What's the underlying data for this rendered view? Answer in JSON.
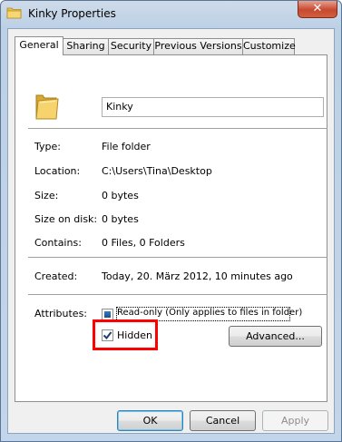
{
  "window": {
    "title": "Kinky Properties",
    "close_glyph": "✕"
  },
  "tabs": [
    {
      "label": "General",
      "active": true
    },
    {
      "label": "Sharing"
    },
    {
      "label": "Security"
    },
    {
      "label": "Previous Versions"
    },
    {
      "label": "Customize"
    }
  ],
  "general": {
    "name_value": "Kinky",
    "type_label": "Type:",
    "type_value": "File folder",
    "location_label": "Location:",
    "location_value": "C:\\Users\\Tina\\Desktop",
    "size_label": "Size:",
    "size_value": "0 bytes",
    "size_on_disk_label": "Size on disk:",
    "size_on_disk_value": "0 bytes",
    "contains_label": "Contains:",
    "contains_value": "0 Files, 0 Folders",
    "created_label": "Created:",
    "created_value": "Today, 20. März 2012, 10 minutes ago",
    "attributes_label": "Attributes:",
    "readonly_label": "Read-only (Only applies to files in folder)",
    "readonly_state": "indeterminate",
    "hidden_label": "Hidden",
    "hidden_checked": true,
    "advanced_label": "Advanced..."
  },
  "buttons": {
    "ok": "OK",
    "cancel": "Cancel",
    "apply": "Apply"
  },
  "colors": {
    "highlight": "#ff0000",
    "close_button": "#c7492f",
    "folder": "#f2c94c"
  },
  "icons": {
    "title": "folder-icon",
    "large": "folder-icon"
  }
}
